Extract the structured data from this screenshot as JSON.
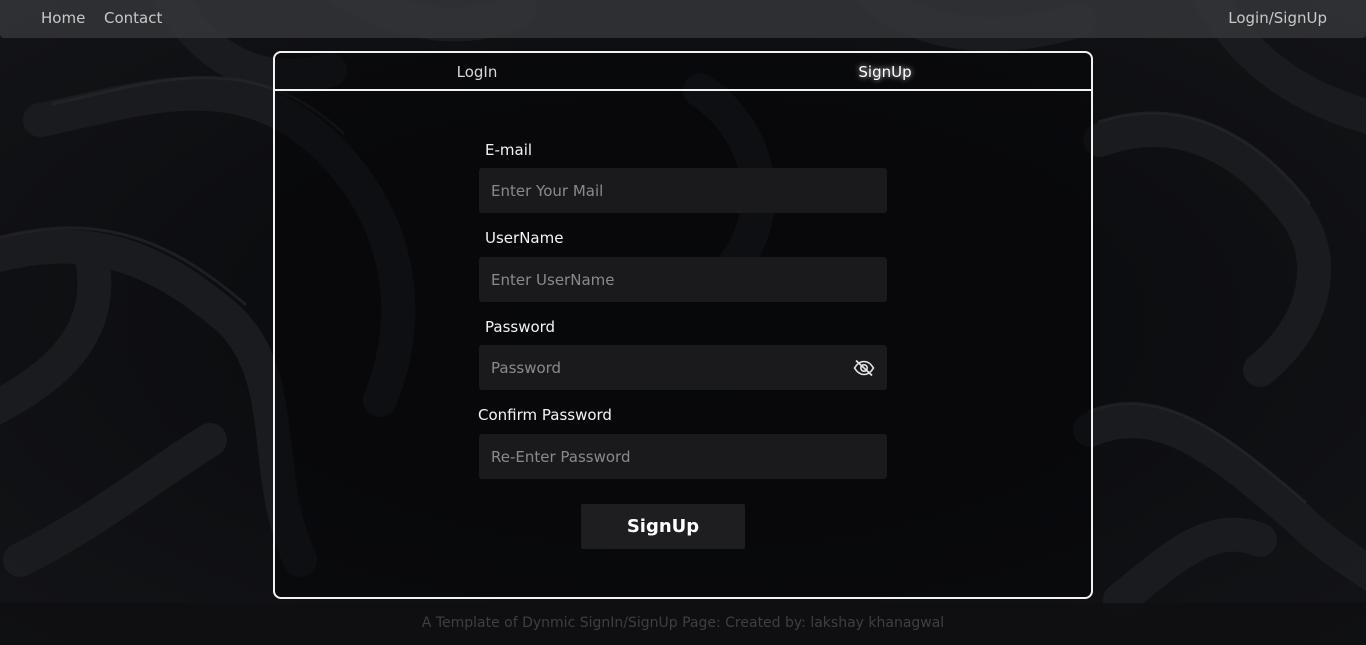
{
  "nav": {
    "home": "Home",
    "contact": "Contact",
    "auth": "Login/SignUp"
  },
  "tabs": {
    "login": "LogIn",
    "signup": "SignUp",
    "active": "signup"
  },
  "form": {
    "email_label": "E-mail",
    "email_placeholder": "Enter Your Mail",
    "username_label": "UserName",
    "username_placeholder": "Enter UserName",
    "password_label": "Password",
    "password_placeholder": "Password",
    "password_toggle_icon": "eye-slash-icon",
    "confirm_label": "Confirm Password",
    "confirm_placeholder": "Re-Enter Password",
    "submit_label": "SignUp"
  },
  "footer": {
    "text": "A Template of Dynmic SignIn/SignUp Page: Created by: lakshay khanagwal"
  },
  "colors": {
    "background": "#08090b",
    "card_border": "#f2f2f2",
    "input_bg": "#1a1a1c"
  }
}
